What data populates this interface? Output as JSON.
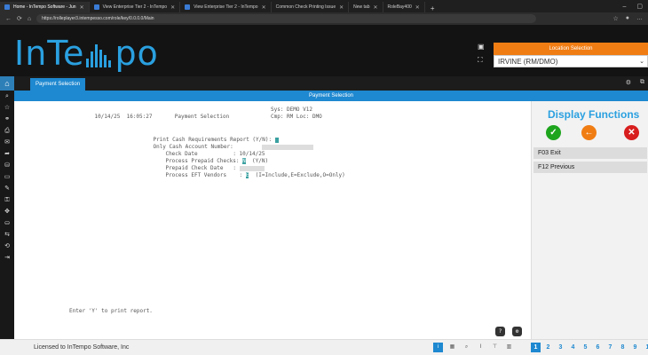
{
  "browser": {
    "tabs": [
      {
        "label": "Home - InTempo Software - Jun",
        "active": true
      },
      {
        "label": "View Enterprise Tier 2 - InTempo",
        "active": false
      },
      {
        "label": "View Enterprise Tier 2 - InTempo",
        "active": false
      },
      {
        "label": "Common Check Printing Issue",
        "active": false
      },
      {
        "label": "New tab",
        "active": false
      },
      {
        "label": "RoleBay400",
        "active": false
      }
    ],
    "url": "https://rolleplayer3.intempesso.com/role/key/0.0.0.0/Main"
  },
  "header": {
    "logo_text_1": "InTe",
    "logo_text_2": "po",
    "location_title": "Location Selection",
    "location_value": "IRVINE (RM/DMO)"
  },
  "app_tab": {
    "label": "Payment Selection"
  },
  "title_bar": "Payment Selection",
  "terminal": {
    "date": "10/14/25",
    "time": "16:05:27",
    "screen_name": "Payment Selection",
    "sys": "Sys: DEMO V12",
    "cmp": "Cmp: RM Loc: DMO",
    "print_label": "Print Cash Requirements Report (Y/N):",
    "cash_account_label": "Only Cash Account Number:",
    "check_date_label": "Check Date",
    "check_date_value": "10/14/25",
    "prepaid_checks_label": "Process Prepaid Checks:",
    "prepaid_checks_value": "N",
    "prepaid_checks_hint": "(Y/N)",
    "prepaid_date_label": "Prepaid Check Date",
    "eft_label": "Process EFT Vendors",
    "eft_value": "E",
    "eft_hint": "(I=Include,E=Exclude,O=Only)",
    "message": "Enter 'Y' to print report."
  },
  "right_panel": {
    "title": "Display Functions",
    "fkeys": [
      "F03 Exit",
      "F12 Previous"
    ]
  },
  "status": {
    "license": "Licensed to InTempo Software, Inc",
    "pages": [
      "1",
      "2",
      "3",
      "4",
      "5",
      "6",
      "7",
      "8",
      "9",
      "1"
    ],
    "active_page": "1"
  },
  "colors": {
    "accent": "#1e88d0",
    "orange": "#f07d14",
    "green": "#1ea51e",
    "red": "#d81e1e",
    "logo": "#2aa0e0"
  }
}
